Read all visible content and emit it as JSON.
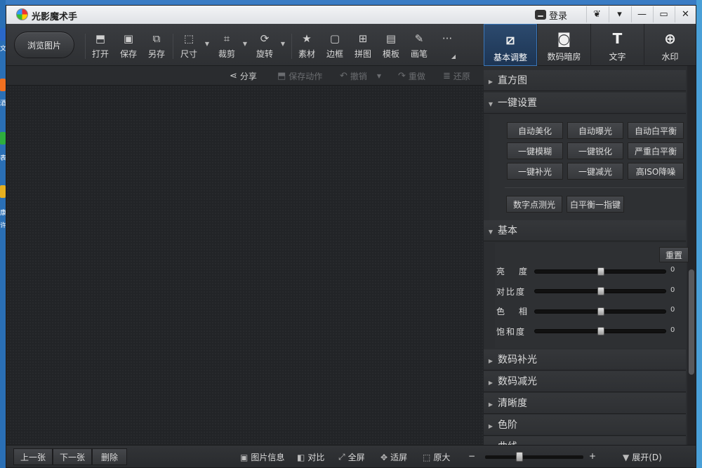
{
  "desktop": {
    "left_labels": [
      "文",
      "酒",
      "表",
      "康",
      "许"
    ]
  },
  "titlebar": {
    "title": "光影魔术手",
    "login_label": "登录",
    "buttons": [
      "❦",
      "▾",
      "—",
      "▭",
      "✕"
    ]
  },
  "toolbar": {
    "browse_label": "浏览图片",
    "tools": [
      {
        "label": "打开",
        "icon": "open-image-icon"
      },
      {
        "label": "保存",
        "icon": "save-icon"
      },
      {
        "label": "另存",
        "icon": "save-as-icon"
      },
      {
        "label": "尺寸",
        "icon": "resize-icon"
      },
      {
        "label": "裁剪",
        "icon": "crop-icon"
      },
      {
        "label": "旋转",
        "icon": "rotate-icon"
      },
      {
        "label": "素材",
        "icon": "material-icon"
      },
      {
        "label": "边框",
        "icon": "border-icon"
      },
      {
        "label": "拼图",
        "icon": "collage-icon"
      },
      {
        "label": "模板",
        "icon": "template-icon"
      },
      {
        "label": "画笔",
        "icon": "brush-icon"
      }
    ],
    "more_label": "···"
  },
  "tabs": [
    {
      "label": "基本调整",
      "icon": "edit-icon",
      "active": true
    },
    {
      "label": "数码暗房",
      "icon": "camera-icon",
      "active": false
    },
    {
      "label": "文字",
      "icon": "text-icon",
      "active": false
    },
    {
      "label": "水印",
      "icon": "watermark-icon",
      "active": false
    }
  ],
  "actionbar": {
    "share": "分享",
    "save_action": "保存动作",
    "undo": "撤销",
    "redo": "重做",
    "restore": "还原"
  },
  "panel": {
    "histogram": "直方图",
    "one_click": {
      "title": "一键设置",
      "buttons": [
        "自动美化",
        "自动曝光",
        "自动白平衡",
        "一键模糊",
        "一键锐化",
        "严重白平衡",
        "一键补光",
        "一键减光",
        "高ISO降噪"
      ],
      "extra_buttons": [
        "数字点测光",
        "白平衡一指键"
      ]
    },
    "basic": {
      "title": "基本",
      "reset": "重置",
      "sliders": [
        {
          "label": "亮　度",
          "value": "0",
          "level": 0.5
        },
        {
          "label": "对比度",
          "value": "0",
          "level": 0.5
        },
        {
          "label": "色　相",
          "value": "0",
          "level": 0.5
        },
        {
          "label": "饱和度",
          "value": "0",
          "level": 0.5
        }
      ]
    },
    "sections": [
      "数码补光",
      "数码减光",
      "清晰度",
      "色阶",
      "曲线"
    ]
  },
  "statusbar": {
    "prev": "上一张",
    "next": "下一张",
    "delete": "删除",
    "info": "图片信息",
    "compare": "对比",
    "fullscreen": "全屏",
    "fit": "适屏",
    "original": "原大",
    "zoom_minus": "−",
    "zoom_plus": "+",
    "zoom_level": 0.35,
    "expand": "展开(D)"
  }
}
